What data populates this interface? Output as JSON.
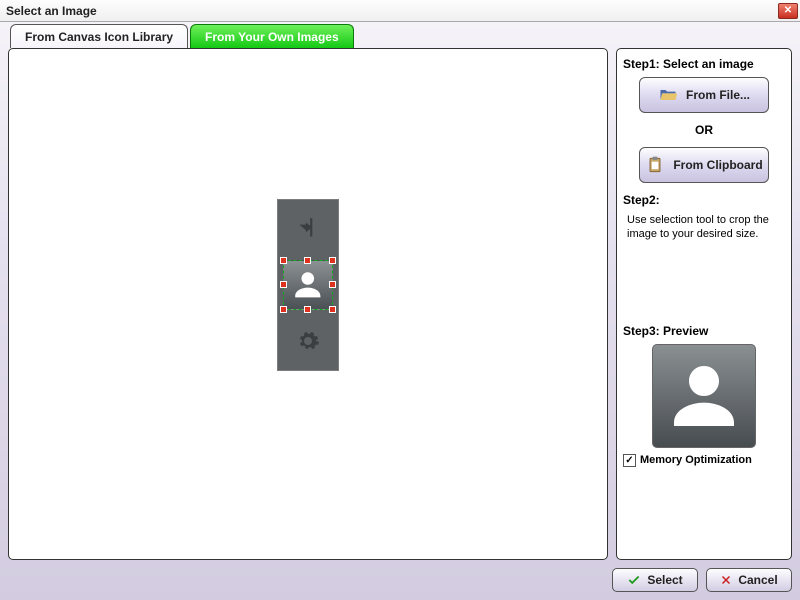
{
  "title": "Select an Image",
  "tabs": {
    "canvas": "From Canvas Icon Library",
    "own": "From Your Own Images"
  },
  "side": {
    "step1_title": "Step1: Select an image",
    "from_file": "From File...",
    "or": "OR",
    "from_clipboard": "From Clipboard",
    "step2_title": "Step2:",
    "step2_text": "Use selection tool to crop the image to your desired size.",
    "step3_title": "Step3: Preview",
    "memopt": "Memory Optimization",
    "memopt_checked": "✓"
  },
  "footer": {
    "select": "Select",
    "cancel": "Cancel"
  },
  "icons": {
    "folder": "folder-open-icon",
    "clipboard": "clipboard-icon",
    "arrow_in": "insert-arrow-icon",
    "person": "person-silhouette-icon",
    "gear": "gear-icon",
    "check": "check-icon",
    "cross": "cross-icon"
  }
}
